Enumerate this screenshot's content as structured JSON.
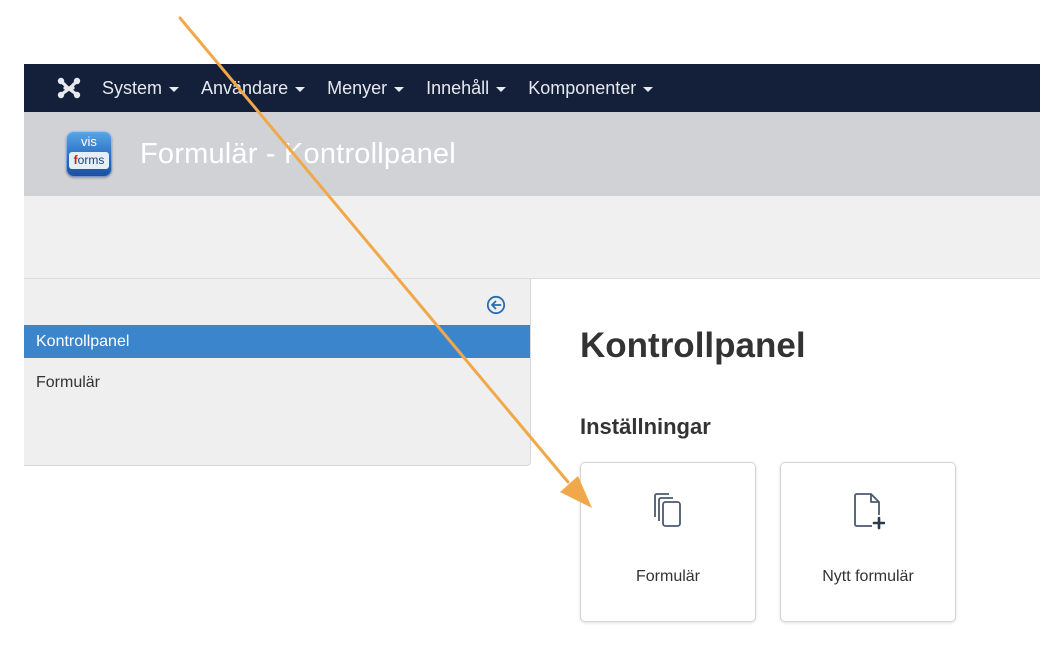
{
  "navbar": {
    "logo_icon": "joomla-icon",
    "items": [
      {
        "label": "System"
      },
      {
        "label": "Användare"
      },
      {
        "label": "Menyer"
      },
      {
        "label": "Innehåll"
      },
      {
        "label": "Komponenter"
      }
    ]
  },
  "titlebar": {
    "logo": {
      "line1": "vis",
      "line2_red": "f",
      "line2_rest": "orms"
    },
    "heading": "Formulär - Kontrollpanel"
  },
  "sidebar": {
    "toggle_icon": "collapse-arrow-left-icon",
    "items": [
      {
        "label": "Kontrollpanel",
        "active": true
      },
      {
        "label": "Formulär",
        "active": false
      }
    ]
  },
  "main": {
    "title": "Kontrollpanel",
    "section": "Inställningar",
    "tiles": [
      {
        "label": "Formulär",
        "icon": "copy-documents-icon"
      },
      {
        "label": "Nytt formulär",
        "icon": "new-document-plus-icon"
      }
    ]
  },
  "annotation": {
    "arrow_color": "#f0a84a"
  },
  "colors": {
    "navbar_bg": "#14203a",
    "titlebar_bg": "#d0d2d6",
    "sidebar_active": "#3a85cb",
    "toolbar_bg": "#f0f0f1"
  }
}
